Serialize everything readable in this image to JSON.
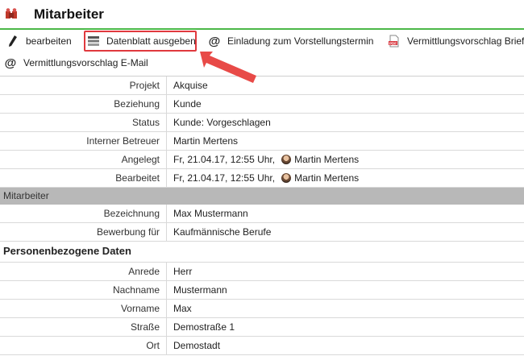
{
  "window": {
    "title": "Mitarbeiter",
    "accent_color": "#4cb848"
  },
  "toolbar": {
    "edit_label": "bearbeiten",
    "datasheet_label": "Datenblatt ausgeben",
    "invite_label": "Einladung zum Vorstellungstermin",
    "letter_label": "Vermittlungsvorschlag Brief",
    "email_label": "Vermittlungsvorschlag E-Mail",
    "highlight_color": "#e0393e"
  },
  "meta": {
    "projekt": {
      "label": "Projekt",
      "value": "Akquise"
    },
    "beziehung": {
      "label": "Beziehung",
      "value": "Kunde"
    },
    "status": {
      "label": "Status",
      "value": "Kunde: Vorgeschlagen"
    },
    "betreuer": {
      "label": "Interner Betreuer",
      "value": "Martin Mertens"
    },
    "angelegt": {
      "label": "Angelegt",
      "date": "Fr, 21.04.17, 12:55 Uhr,",
      "user": "Martin Mertens"
    },
    "bearbeitet": {
      "label": "Bearbeitet",
      "date": "Fr, 21.04.17, 12:55 Uhr,",
      "user": "Martin Mertens"
    }
  },
  "mitarbeiter_section": {
    "title": "Mitarbeiter",
    "bezeichnung": {
      "label": "Bezeichnung",
      "value": "Max Mustermann"
    },
    "bewerbung": {
      "label": "Bewerbung für",
      "value": "Kaufmännische Berufe"
    }
  },
  "personal_section": {
    "title": "Personenbezogene Daten",
    "anrede": {
      "label": "Anrede",
      "value": "Herr"
    },
    "nachname": {
      "label": "Nachname",
      "value": "Mustermann"
    },
    "vorname": {
      "label": "Vorname",
      "value": "Max"
    },
    "strasse": {
      "label": "Straße",
      "value": "Demostraße 1"
    },
    "ort": {
      "label": "Ort",
      "value": "Demostadt"
    }
  }
}
